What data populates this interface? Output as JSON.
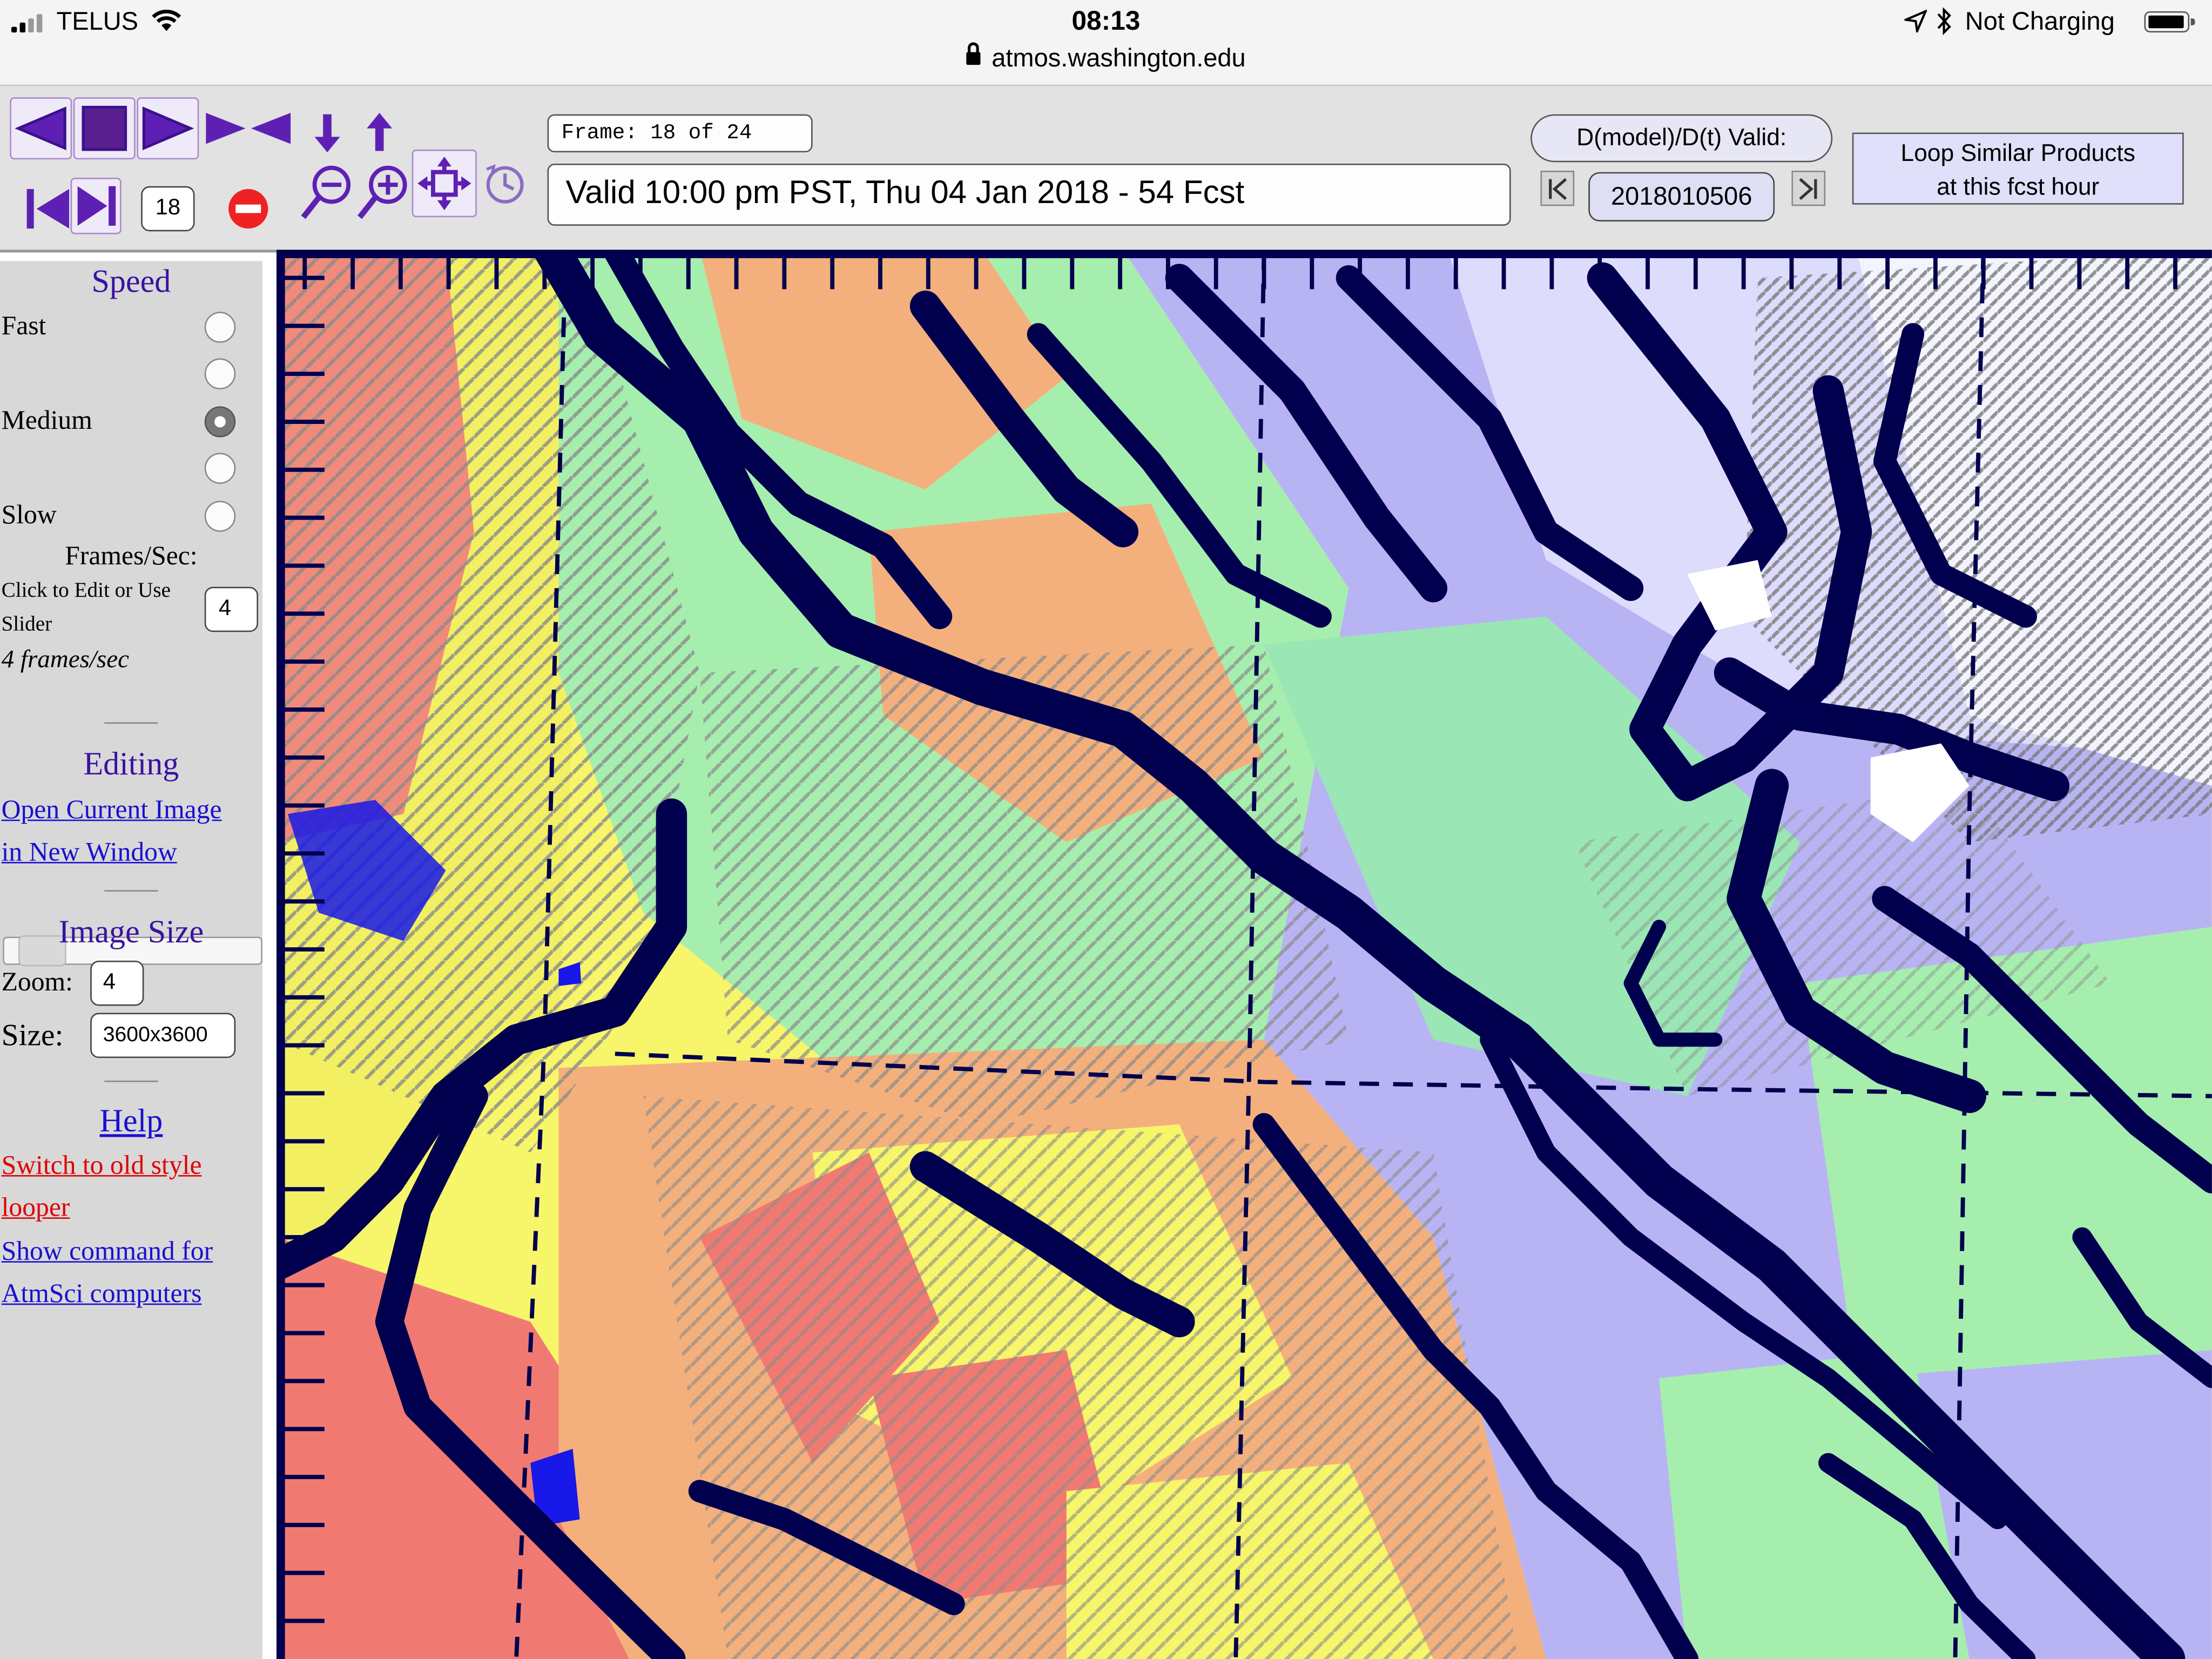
{
  "status_bar": {
    "carrier": "TELUS",
    "time": "08:13",
    "charging": "Not Charging",
    "url": "atmos.washington.edu"
  },
  "toolbar": {
    "frame_label": "Frame: 18 of 24",
    "valid_text": "Valid 10:00 pm PST, Thu 04 Jan 2018 - 54 Fcst",
    "frame_number": "18",
    "ddt_label": "D(model)/D(t) Valid:",
    "model_date": "2018010506",
    "loop_similar_line1": "Loop Similar Products",
    "loop_similar_line2": "at this fcst hour"
  },
  "sidebar": {
    "speed_title": "Speed",
    "speed_options": [
      {
        "label": "Fast",
        "selected": false
      },
      {
        "label": "",
        "selected": false
      },
      {
        "label": "Medium",
        "selected": true
      },
      {
        "label": "",
        "selected": false
      },
      {
        "label": "Slow",
        "selected": false
      }
    ],
    "fps_title": "Frames/Sec:",
    "fps_hint_line1": "Click to Edit or Use",
    "fps_hint_line2": "Slider",
    "fps_value": "4",
    "fps_readout": "4 frames/sec",
    "slider_fraction": 0.05,
    "editing_title": "Editing",
    "open_image_line1": "Open Current Image",
    "open_image_line2": "in New Window",
    "image_size_title": "Image Size",
    "zoom_label": "Zoom:",
    "zoom_value": "4",
    "size_label": "Size:",
    "size_value": "3600x3600",
    "help_link": "Help",
    "old_style_line1": "Switch to old style",
    "old_style_line2": "looper",
    "command_line1": "Show command for",
    "command_line2": "AtmSci computers"
  },
  "colors": {
    "toolbar_bg": "#e2e2e2",
    "button_purple": "#5e20b4",
    "link_blue": "#1a0fd0",
    "link_red": "#e00000",
    "section_heading": "#3a12a0",
    "map_coast": "#00004e"
  },
  "icons": {
    "prev": "triangle-left-icon",
    "stop": "square-stop-icon",
    "next": "triangle-right-icon",
    "rock": "bounce-icon",
    "slower": "arrow-down-icon",
    "faster": "arrow-up-icon",
    "first": "first-frame-icon",
    "last": "last-frame-icon",
    "no_entry": "no-entry-icon",
    "zoom_out": "magnifier-minus-icon",
    "zoom_in": "magnifier-plus-icon",
    "pan": "pan-arrows-icon",
    "reset": "reset-clock-icon"
  }
}
